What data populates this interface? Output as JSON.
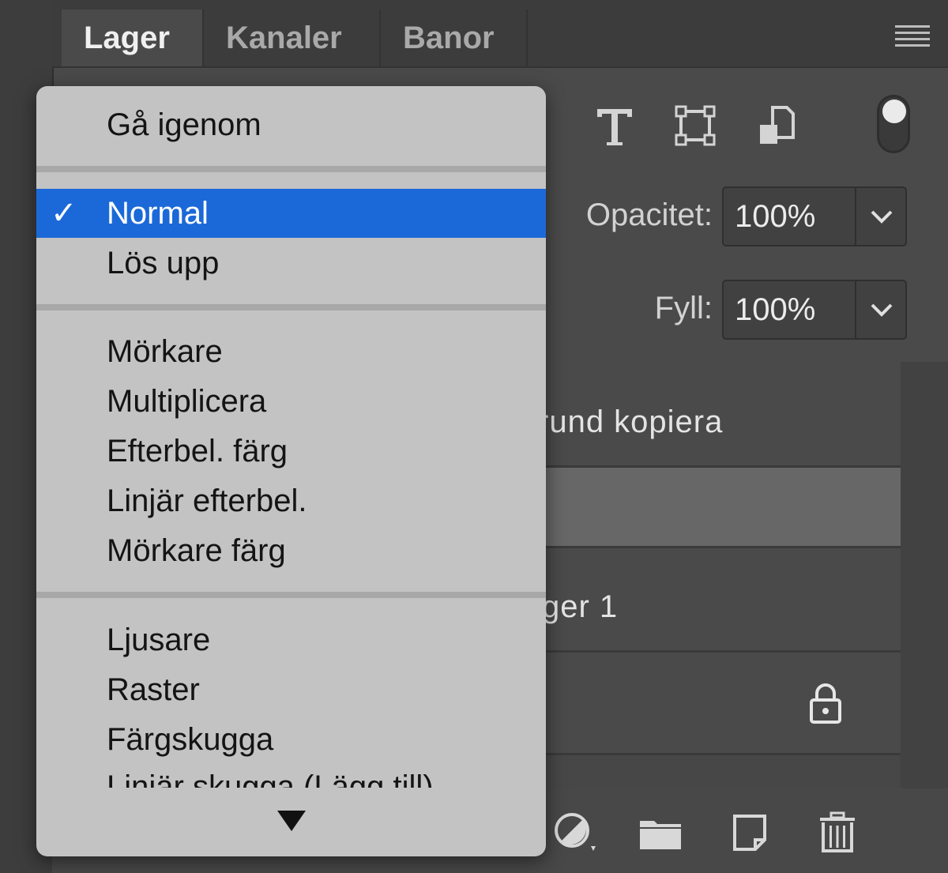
{
  "tabs": [
    {
      "label": "Lager",
      "active": true
    },
    {
      "label": "Kanaler",
      "active": false
    },
    {
      "label": "Banor",
      "active": false
    }
  ],
  "panel_menu_icon": "hamburger-icon",
  "filter_icons": [
    "type-filter-icon",
    "shape-filter-icon",
    "smart-object-filter-icon"
  ],
  "properties": {
    "opacity_label": "Opacitet:",
    "opacity_value": "100%",
    "fill_label": "Fyll:",
    "fill_value": "100%"
  },
  "layers": [
    {
      "name_visible": "rund kopiera",
      "selected": false
    },
    {
      "name_visible": "",
      "selected": true
    },
    {
      "name_visible": "ger 1",
      "selected": false
    },
    {
      "name_visible": "",
      "selected": false,
      "locked": true
    }
  ],
  "blend_menu": {
    "groups": [
      [
        "Gå igenom"
      ],
      [
        "Normal",
        "Lös upp"
      ],
      [
        "Mörkare",
        "Multiplicera",
        "Efterbel. färg",
        "Linjär efterbel.",
        "Mörkare färg"
      ],
      [
        "Ljusare",
        "Raster",
        "Färgskugga",
        "Linjär skugga (Lägg till)"
      ]
    ],
    "selected": "Normal",
    "check_glyph": "✓",
    "more_indicator": "scroll-down-arrow-icon"
  },
  "bottom_icons": [
    "adjustment-layer-icon",
    "group-folder-icon",
    "new-layer-icon",
    "trash-icon"
  ],
  "colors": {
    "accent": "#1b69d8",
    "menu_bg": "#c3c3c3",
    "panel_bg": "#4a4a4a"
  }
}
